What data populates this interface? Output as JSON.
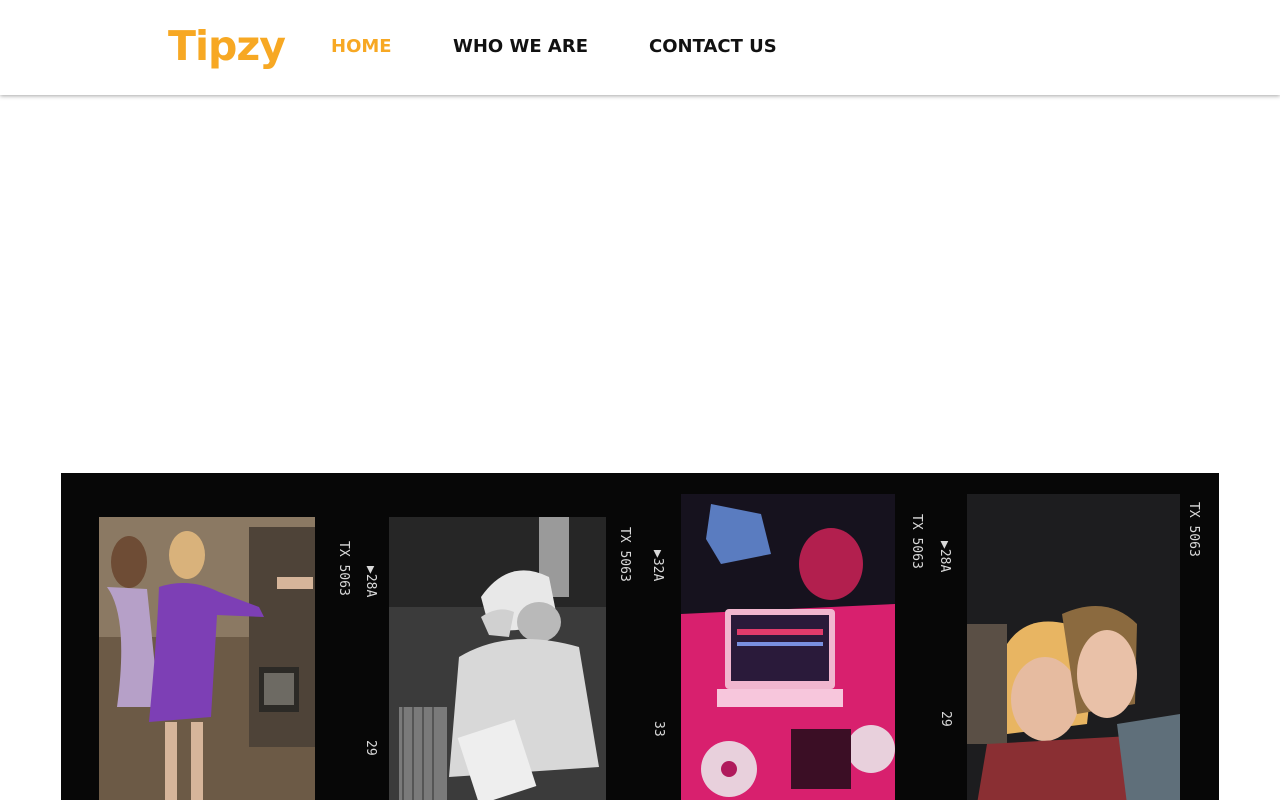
{
  "brand": {
    "name": "Tipzy",
    "color": "#f7a823"
  },
  "nav": {
    "items": [
      {
        "label": "HOME",
        "active": true
      },
      {
        "label": "WHO WE ARE",
        "active": false
      },
      {
        "label": "CONTACT US",
        "active": false
      }
    ]
  },
  "filmstrip": {
    "edge_codes": [
      "TX 5063",
      "▶28A",
      "29",
      "TX 5063",
      "▶32A",
      "33",
      "TX 5063",
      "▶28A",
      "29",
      "TX 5063"
    ],
    "photos": [
      {
        "name": "dancing-friends-photo",
        "tone": "color"
      },
      {
        "name": "dj-vinyl-photo",
        "tone": "black-and-white"
      },
      {
        "name": "dj-laptop-photo",
        "tone": "pink-light"
      },
      {
        "name": "smiling-couple-photo",
        "tone": "color"
      }
    ]
  }
}
